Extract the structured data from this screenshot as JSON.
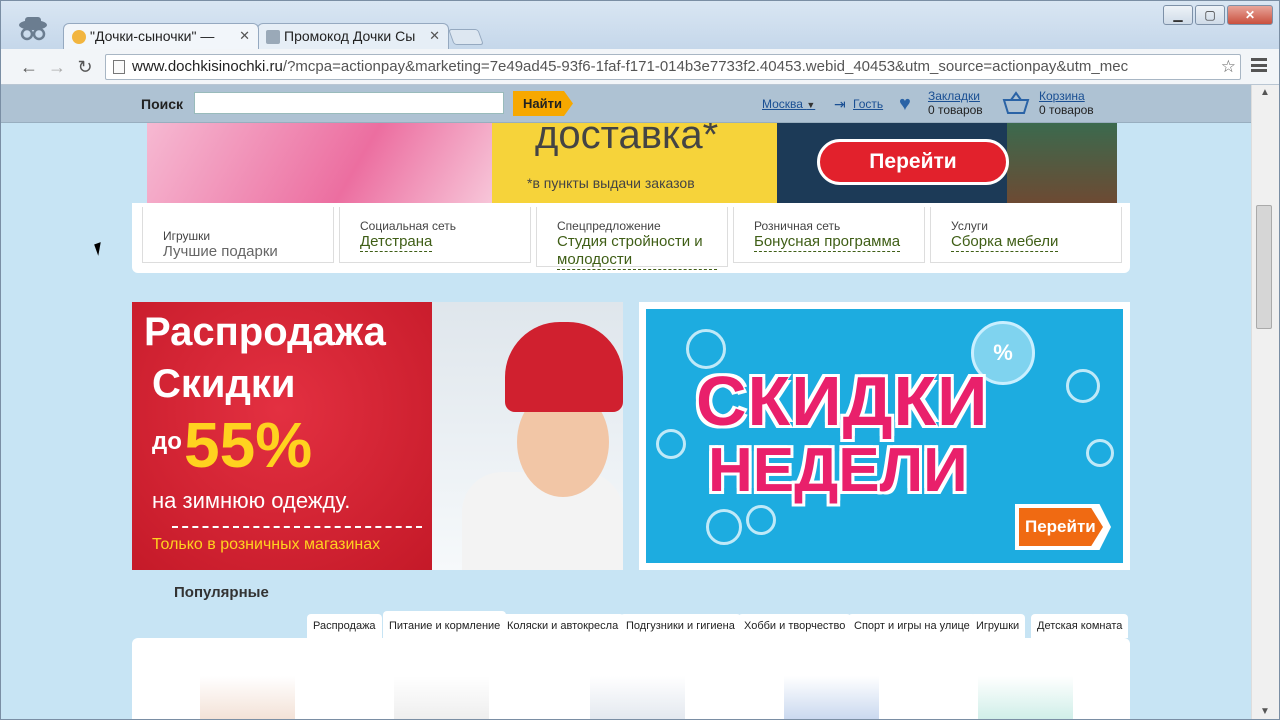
{
  "browser": {
    "tabs": [
      {
        "label": "\"Дочки-сыночки\" — ",
        "active": true
      },
      {
        "label": "Промокод Дочки Сы",
        "active": false
      }
    ],
    "url_host": "www.dochkisinochki.ru",
    "url_rest": "/?mcpa=actionpay&marketing=7e49ad45-93f6-1faf-f171-014b3e7733f2.40453.webid_40453&utm_source=actionpay&utm_mec"
  },
  "header": {
    "search_label": "Поиск",
    "search_button": "Найти",
    "city": "Москва",
    "guest": "Гость",
    "bookmarks_label": "Закладки",
    "bookmarks_count": "0 товаров",
    "cart_label": "Корзина",
    "cart_count": "0 товаров"
  },
  "promo": {
    "title": "доставка*",
    "note": "*в пункты выдачи заказов",
    "button": "Перейти"
  },
  "info_strip": [
    {
      "category": "Игрушки",
      "link": "Лучшие подарки"
    },
    {
      "category": "Социальная сеть",
      "link": "Детстрана"
    },
    {
      "category": "Спецпредложение",
      "link": "Студия стройности и молодости"
    },
    {
      "category": "Розничная сеть",
      "link": "Бонусная программа"
    },
    {
      "category": "Услуги",
      "link": "Сборка мебели"
    }
  ],
  "sale_banner": {
    "line1": "Распродажа",
    "line2": "Скидки",
    "line3": "до",
    "percent": "55%",
    "line4": "на зимнюю одежду.",
    "line5": "Только в розничных магазинах"
  },
  "week_banner": {
    "line1": "СКИДКИ",
    "line2": "НЕДЕЛИ",
    "badge": "%",
    "button": "Перейти"
  },
  "popular": {
    "title": "Популярные",
    "tabs": [
      "Распродажа",
      "Питание и кормление",
      "Коляски и автокресла",
      "Подгузники и гигиена",
      "Хобби и творчество",
      "Спорт и игры на улице",
      "Игрушки",
      "Детская комната"
    ],
    "active_tab": "Питание и кормление"
  },
  "colors": {
    "accent_orange": "#f7a800",
    "link_blue": "#1a4f93",
    "sale_red": "#c8192a",
    "week_blue": "#1dace0",
    "week_pink": "#e9206b"
  }
}
